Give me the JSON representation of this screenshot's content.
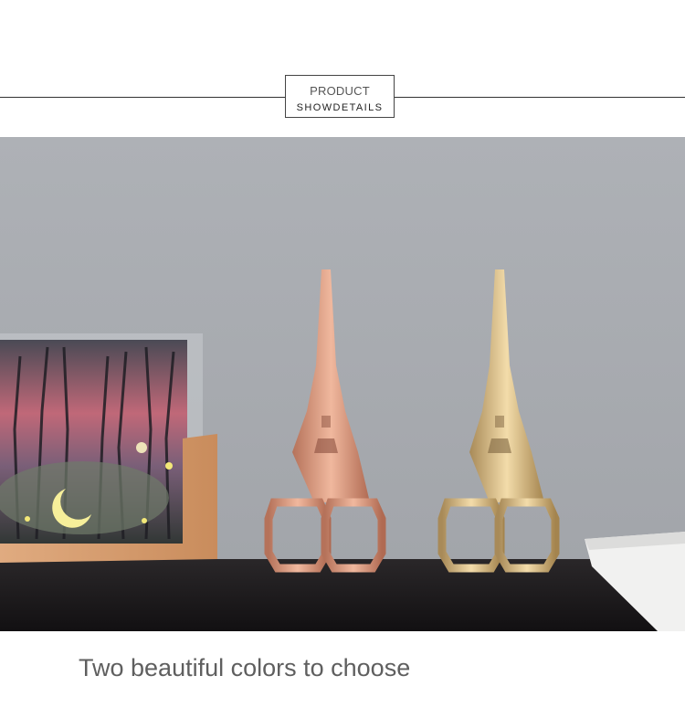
{
  "header": {
    "title": "PRODUCT",
    "subtitle": "SHOWDETAILS"
  },
  "photo": {
    "left_item": "rose-gold-eiffel-tower-scissors",
    "right_item": "gold-eiffel-tower-scissors",
    "colors": {
      "wall": "#aaaeb3",
      "shelf": "#1c1a1d",
      "rose_gold": "#d9987c",
      "gold": "#d8bd8a",
      "wood": "#d9a072"
    }
  },
  "caption": {
    "text": "Two beautiful colors to choose"
  }
}
